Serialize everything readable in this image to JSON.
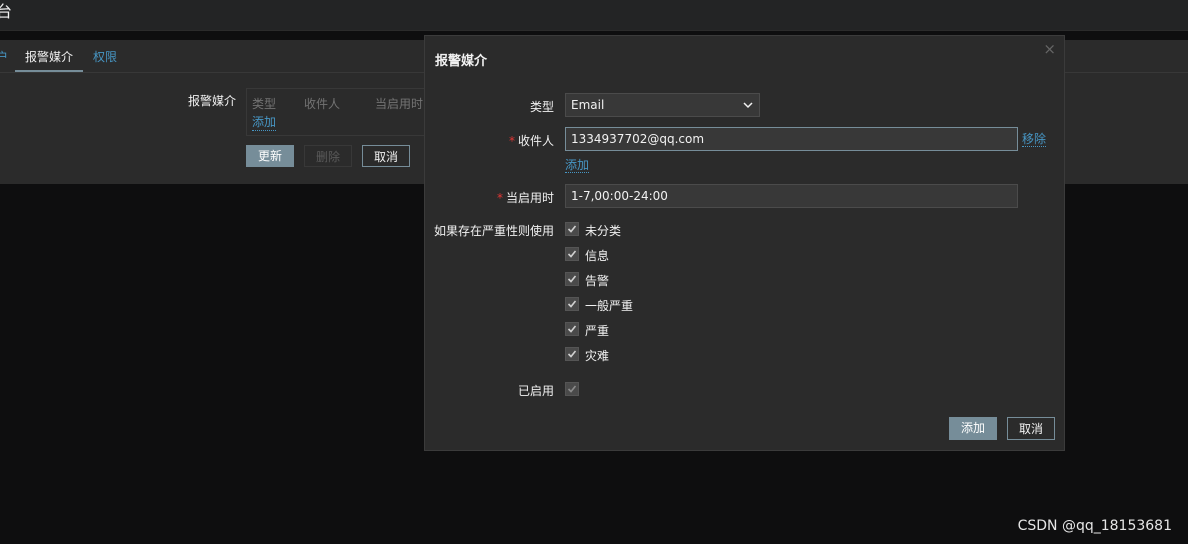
{
  "top": {
    "title": "台"
  },
  "tabs": [
    "户",
    "报警媒介",
    "权限"
  ],
  "background": {
    "media_label": "报警媒介",
    "columns": [
      "类型",
      "收件人",
      "当启用时"
    ],
    "add_link": "添加",
    "buttons": {
      "update": "更新",
      "delete": "删除",
      "cancel": "取消"
    }
  },
  "dialog": {
    "title": "报警媒介",
    "close_glyph": "×",
    "type_label": "类型",
    "type_value": "Email",
    "recipient_label": "收件人",
    "recipient_value": "1334937702@qq.com",
    "remove_link": "移除",
    "add_link": "添加",
    "when_label": "当启用时",
    "when_value": "1-7,00:00-24:00",
    "severity_label": "如果存在严重性则使用",
    "severities": [
      {
        "label": "未分类",
        "checked": true
      },
      {
        "label": "信息",
        "checked": true
      },
      {
        "label": "告警",
        "checked": true
      },
      {
        "label": "一般严重",
        "checked": true
      },
      {
        "label": "严重",
        "checked": true
      },
      {
        "label": "灾难",
        "checked": true
      }
    ],
    "enabled_label": "已启用",
    "enabled_checked": true,
    "buttons": {
      "add": "添加",
      "cancel": "取消"
    }
  },
  "watermark": "CSDN @qq_18153681",
  "colors": {
    "link": "#4796c4",
    "primary_button": "#768d99",
    "required": "#e33734"
  }
}
